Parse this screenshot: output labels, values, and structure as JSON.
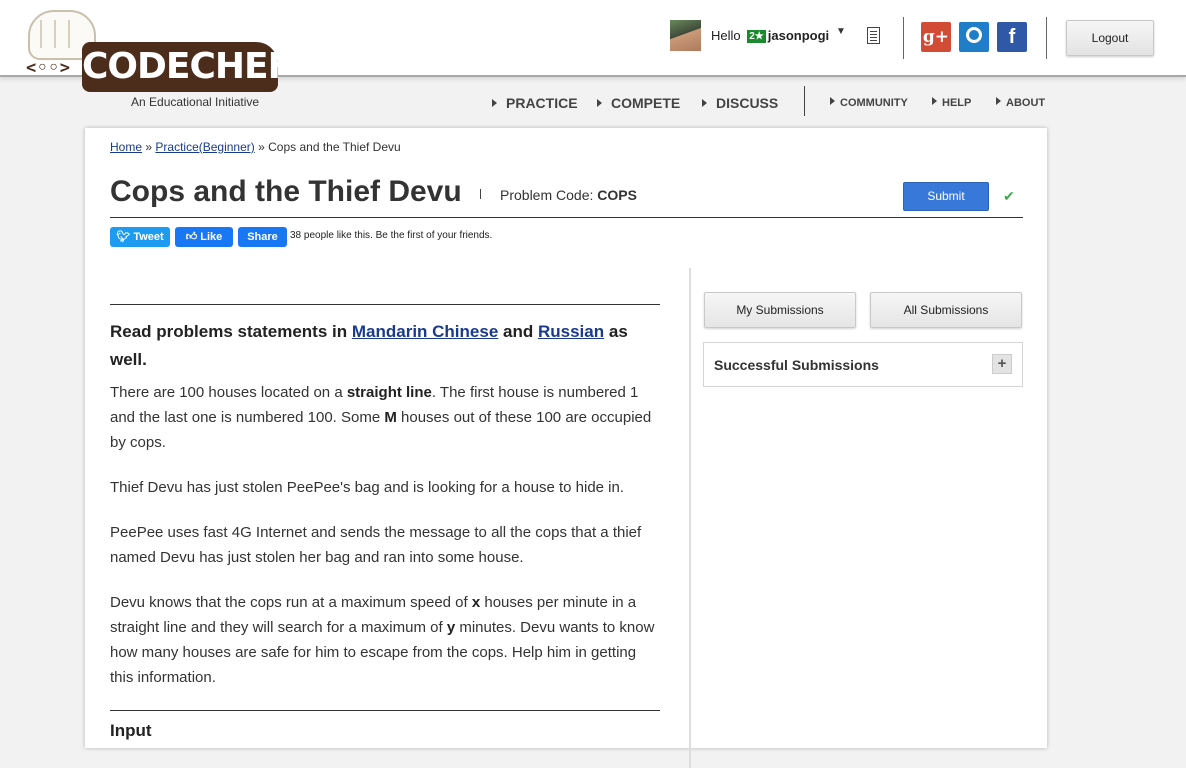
{
  "brand": {
    "face_text": "<◦◦>",
    "name": "CODECHEF",
    "tagline": "An Educational Initiative"
  },
  "user": {
    "greeting": "Hello",
    "rating_badge": "2★",
    "username": "jasonpogi"
  },
  "social": {
    "gplus": "g+",
    "facebook": "f"
  },
  "header": {
    "logout_label": "Logout"
  },
  "nav": {
    "primary": [
      "PRACTICE",
      "COMPETE",
      "DISCUSS"
    ],
    "secondary": [
      "COMMUNITY",
      "HELP",
      "ABOUT"
    ]
  },
  "breadcrumb": {
    "home": "Home",
    "sep1": "»",
    "practice": "Practice(Beginner)",
    "sep2": "»",
    "current": "Cops and the Thief Devu"
  },
  "problem": {
    "title": "Cops and the Thief Devu",
    "code_label": "Problem Code:",
    "code": "COPS",
    "submit_label": "Submit",
    "check": "✔"
  },
  "share": {
    "tweet": "Tweet",
    "like": "Like",
    "share": "Share",
    "like_text": "38 people like this. Be the first of your friends."
  },
  "statement": {
    "lead_prefix": "Read problems statements in",
    "lang1": "Mandarin Chinese",
    "lead_and": "and",
    "lang2": "Russian",
    "lead_suffix": "as well.",
    "p1": {
      "a": "There are 100 houses located on a",
      "b": "straight line",
      "c": ". The first house is numbered 1 and the last one is numbered 100. Some",
      "d": "M",
      "e": "houses out of these 100 are occupied by cops."
    },
    "p2": "Thief Devu has just stolen PeePee's bag and is looking for a house to hide in.",
    "p3": "PeePee uses fast 4G Internet and sends the message to all the cops that a thief named Devu has just stolen her bag and ran into some house.",
    "p4": {
      "a": "Devu knows that the cops run at a maximum speed of",
      "b": "x",
      "c": "houses per minute in a straight line and they will search for a maximum of",
      "d": "y",
      "e": "minutes. Devu wants to know how many houses are safe for him to escape from the cops. Help him in getting this information."
    },
    "input_heading": "Input"
  },
  "sidebar": {
    "my_submissions": "My Submissions",
    "all_submissions": "All Submissions",
    "successful_title": "Successful Submissions",
    "expand": "+"
  }
}
